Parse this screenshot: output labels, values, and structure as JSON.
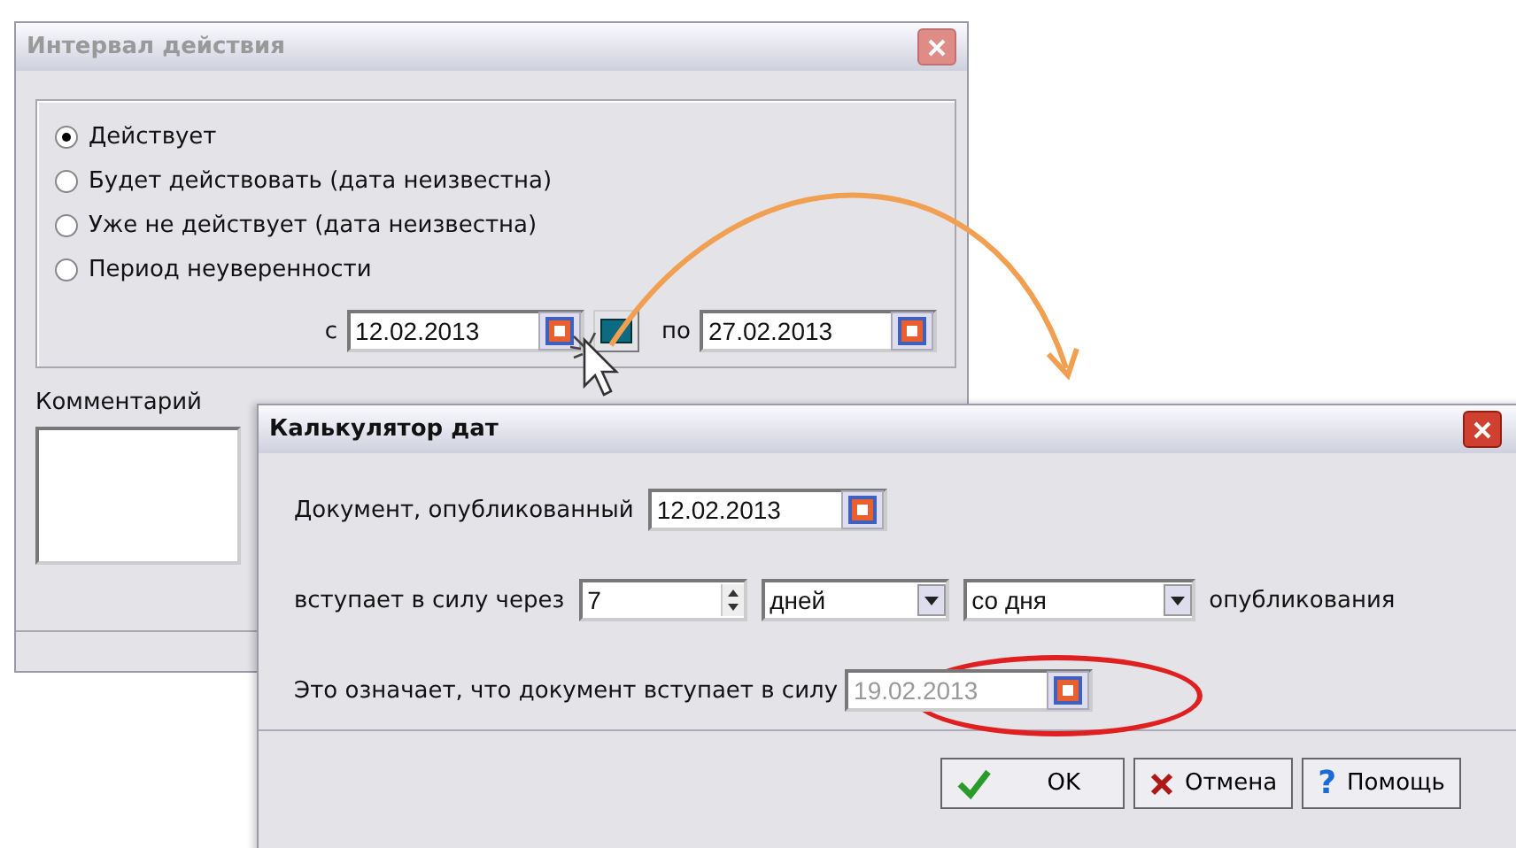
{
  "back_dialog": {
    "title": "Интервал действия",
    "status_options": [
      {
        "label": "Действует",
        "selected": true
      },
      {
        "label": "Будет действовать (дата неизвестна)",
        "selected": false
      },
      {
        "label": "Уже не действует (дата неизвестна)",
        "selected": false
      },
      {
        "label": "Период неуверенности",
        "selected": false
      }
    ],
    "from_label": "с",
    "from_date": "12.02.2013",
    "to_label": "по",
    "to_date": "27.02.2013",
    "comment_label": "Комментарий"
  },
  "front_dialog": {
    "title": "Калькулятор дат",
    "published_label": "Документ, опубликованный",
    "published_date": "12.02.2013",
    "offset_label": "вступает в силу через",
    "offset_value": "7",
    "unit": "дней",
    "base": "со дня",
    "suffix": "опубликования",
    "result_label": "Это означает, что документ вступает в силу",
    "result_date": "19.02.2013",
    "buttons": [
      {
        "kind": "ok",
        "label": "OK"
      },
      {
        "kind": "cancel",
        "label": "Отмена"
      },
      {
        "kind": "help",
        "icon": "?",
        "label": "Помощь"
      }
    ]
  }
}
